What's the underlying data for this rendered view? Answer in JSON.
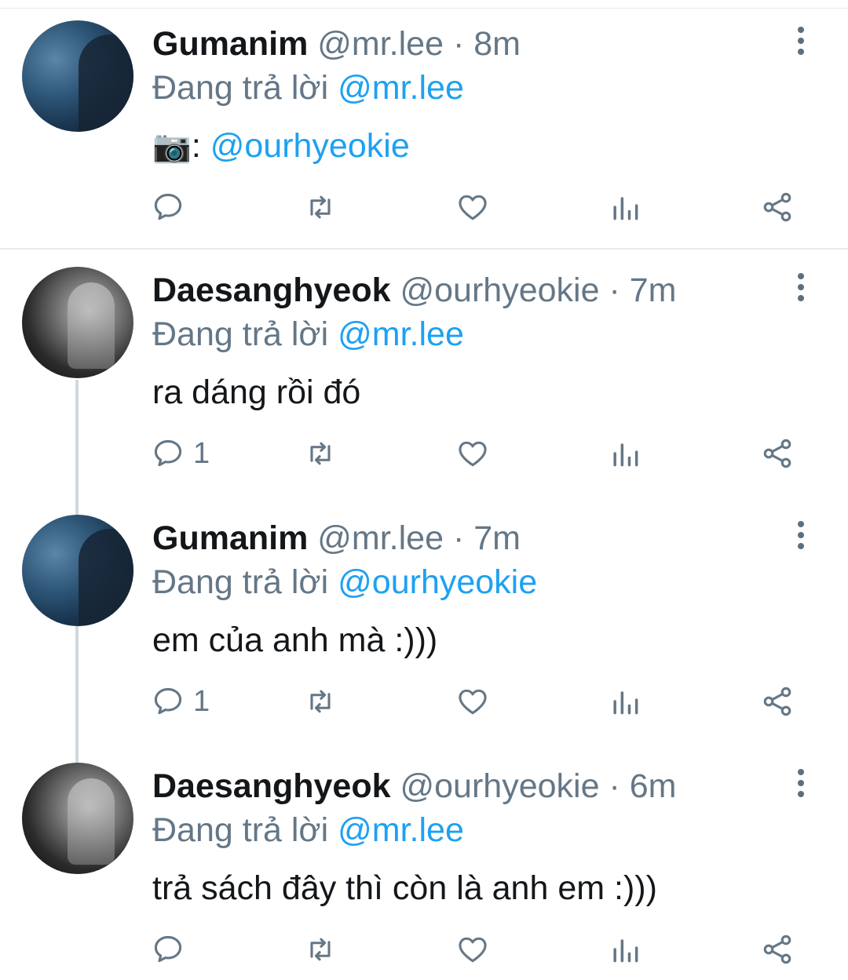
{
  "colors": {
    "accent": "#1da1f2",
    "secondary_text": "#657786",
    "icon": "#657786"
  },
  "tweets": [
    {
      "name": "Gumanim",
      "handle": "@mr.lee",
      "time": "· 8m",
      "replying_prefix": "Đang trả lời",
      "replying_to": "@mr.lee",
      "body_emoji": "📷",
      "body_text": ":",
      "body_mention": "@ourhyeokie",
      "reply_count": "",
      "avatar": "blue"
    },
    {
      "name": "Daesanghyeok",
      "handle": "@ourhyeokie",
      "time": "· 7m",
      "replying_prefix": "Đang trả lời",
      "replying_to": "@mr.lee",
      "body_text": "ra dáng rồi đó",
      "reply_count": "1",
      "avatar": "mono"
    },
    {
      "name": "Gumanim",
      "handle": "@mr.lee",
      "time": "· 7m",
      "replying_prefix": "Đang trả lời",
      "replying_to": "@ourhyeokie",
      "body_text": "em của anh mà :)))",
      "reply_count": "1",
      "avatar": "blue"
    },
    {
      "name": "Daesanghyeok",
      "handle": "@ourhyeokie",
      "time": "· 6m",
      "replying_prefix": "Đang trả lời",
      "replying_to": "@mr.lee",
      "body_text": "trả sách đây thì còn là anh em :)))",
      "reply_count": "",
      "avatar": "mono"
    }
  ],
  "icons": {
    "reply": "reply-icon",
    "retweet": "retweet-icon",
    "like": "heart-icon",
    "analytics": "analytics-icon",
    "share": "share-icon",
    "more": "more-vertical-icon"
  }
}
